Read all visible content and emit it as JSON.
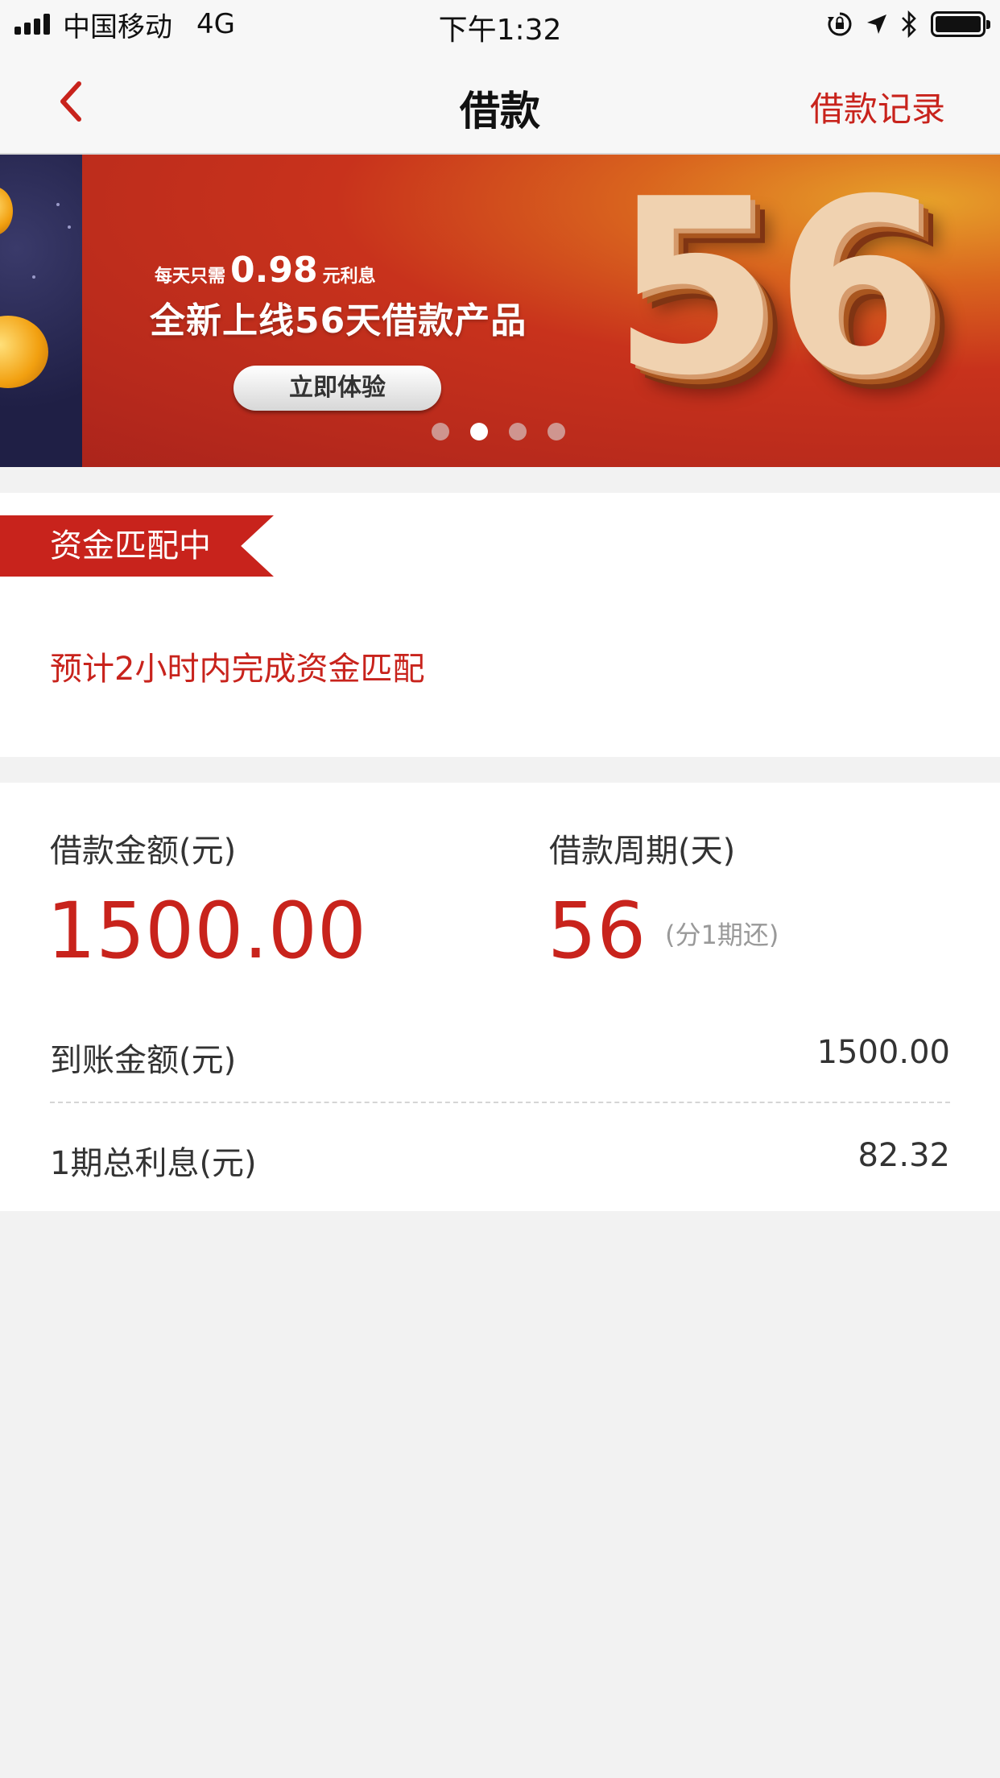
{
  "status_bar": {
    "carrier": "中国移动",
    "network": "4G",
    "time": "下午1:32",
    "battery_level": 1.0
  },
  "nav": {
    "title": "借款",
    "right_link": "借款记录"
  },
  "banner": {
    "subtitle_prefix": "每天只需",
    "subtitle_amount": "0.98",
    "subtitle_suffix": "元利息",
    "title": "全新上线56天借款产品",
    "button_label": "立即体验",
    "big_number": "56",
    "slide_count": 4,
    "active_slide": 2
  },
  "status_card": {
    "badge": "资金匹配中",
    "message": "预计2小时内完成资金匹配"
  },
  "loan": {
    "amount_label": "借款金额(元)",
    "amount_value": "1500.00",
    "period_label": "借款周期(天)",
    "period_value": "56",
    "period_note": "(分1期还)",
    "received_label": "到账金额(元)",
    "received_value": "1500.00",
    "interest_label": "1期总利息(元)",
    "interest_value": "82.32"
  },
  "colors": {
    "accent_red": "#c8231c",
    "page_bg": "#f2f2f2",
    "text_dark": "#333333",
    "text_muted": "#999999"
  }
}
